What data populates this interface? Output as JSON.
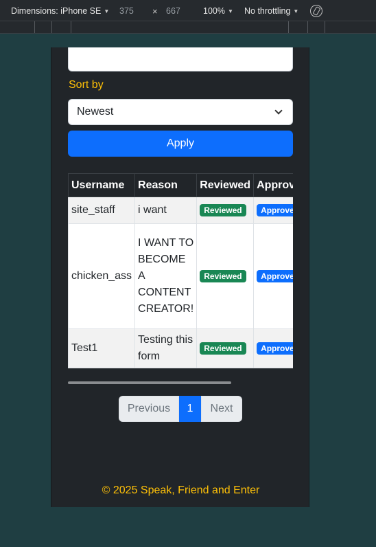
{
  "devtools": {
    "device_label": "Dimensions: iPhone SE",
    "width": "375",
    "times": "×",
    "height": "667",
    "zoom": "100%",
    "throttle": "No throttling",
    "rotate_icon": "rotate-icon"
  },
  "filter": {
    "sort_label": "Sort by",
    "sort_value": "Newest",
    "apply_label": "Apply"
  },
  "table": {
    "headers": [
      "Username",
      "Reason",
      "Reviewed",
      "Approv"
    ],
    "rows": [
      {
        "username": "site_staff",
        "reason": "i want",
        "reviewed": "Reviewed",
        "approved": "Approved"
      },
      {
        "username": "chicken_ass",
        "reason": "I WANT TO BECOME A CONTENT CREATOR!",
        "reviewed": "Reviewed",
        "approved": "Approved"
      },
      {
        "username": "Test1",
        "reason": "Testing this form",
        "reviewed": "Reviewed",
        "approved": "Approved"
      }
    ]
  },
  "pagination": {
    "previous": "Previous",
    "current": "1",
    "next": "Next"
  },
  "footer": {
    "text": "© 2025 Speak, Friend and Enter"
  },
  "colors": {
    "accent": "#ffc107",
    "primary": "#0d6efd",
    "success": "#198754",
    "background": "#212529"
  }
}
